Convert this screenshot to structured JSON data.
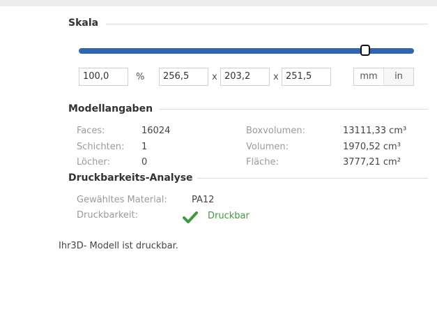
{
  "scale": {
    "title": "Skala",
    "percent_value": "100,0",
    "percent_label": "%",
    "x_value": "256,5",
    "sep1": "x",
    "y_value": "203,2",
    "sep2": "x",
    "z_value": "251,5",
    "units": [
      "mm",
      "in"
    ],
    "selected_unit": "mm",
    "slider_fraction": 0.84
  },
  "model": {
    "title": "Modellangaben",
    "left": [
      {
        "label": "Faces:",
        "value": "16024"
      },
      {
        "label": "Schichten:",
        "value": "1"
      },
      {
        "label": "Löcher:",
        "value": "0"
      }
    ],
    "right": [
      {
        "label": "Boxvolumen:",
        "value": "13111,33 cm³"
      },
      {
        "label": "Volumen:",
        "value": "1970,52 cm³"
      },
      {
        "label": "Fläche:",
        "value": "3777,21 cm²"
      }
    ]
  },
  "analysis": {
    "title": "Druckbarkeits-Analyse",
    "material_label": "Gewähltes Material:",
    "material_value": "PA12",
    "printability_label": "Druckbarkeit:",
    "printability_value": "Druckbar",
    "status_color": "#3c9a3c"
  },
  "message": "Ihr3D- Modell ist druckbar.",
  "colors": {
    "accent": "#2f66b3",
    "success": "#3c9a3c"
  },
  "icons": {
    "status": "checkmark-icon"
  }
}
